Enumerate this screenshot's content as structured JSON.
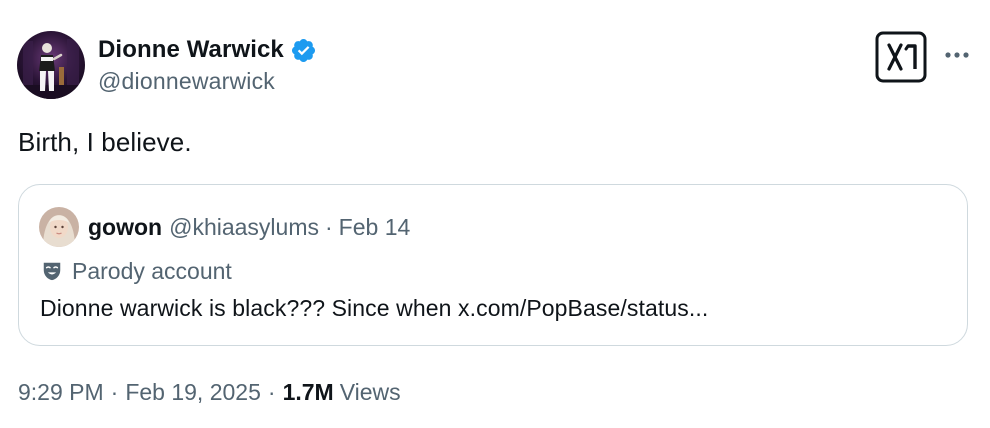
{
  "tweet": {
    "author": {
      "name": "Dionne Warwick",
      "handle": "@dionnewarwick",
      "verified": true
    },
    "text": "Birth, I believe.",
    "quoted_tweet": {
      "author_name": "gowon",
      "author_handle": "@khiaasylums",
      "separator": "·",
      "date": "Feb 14",
      "badge_label": "Parody account",
      "text": "Dionne warwick is black??? Since when x.com/PopBase/status..."
    },
    "meta": {
      "time": "9:29 PM",
      "separator": "·",
      "date": "Feb 19, 2025",
      "views_count": "1.7M",
      "views_label": "Views"
    }
  },
  "colors": {
    "primary_text": "#0f1419",
    "secondary_text": "#536471",
    "verified_blue": "#1d9bf0",
    "border": "#cfd9de"
  },
  "icons": {
    "verified": "verified-badge-icon",
    "x_logo": "x-logo-icon",
    "more": "more-horizontal-icon",
    "parody": "parody-mask-icon"
  }
}
